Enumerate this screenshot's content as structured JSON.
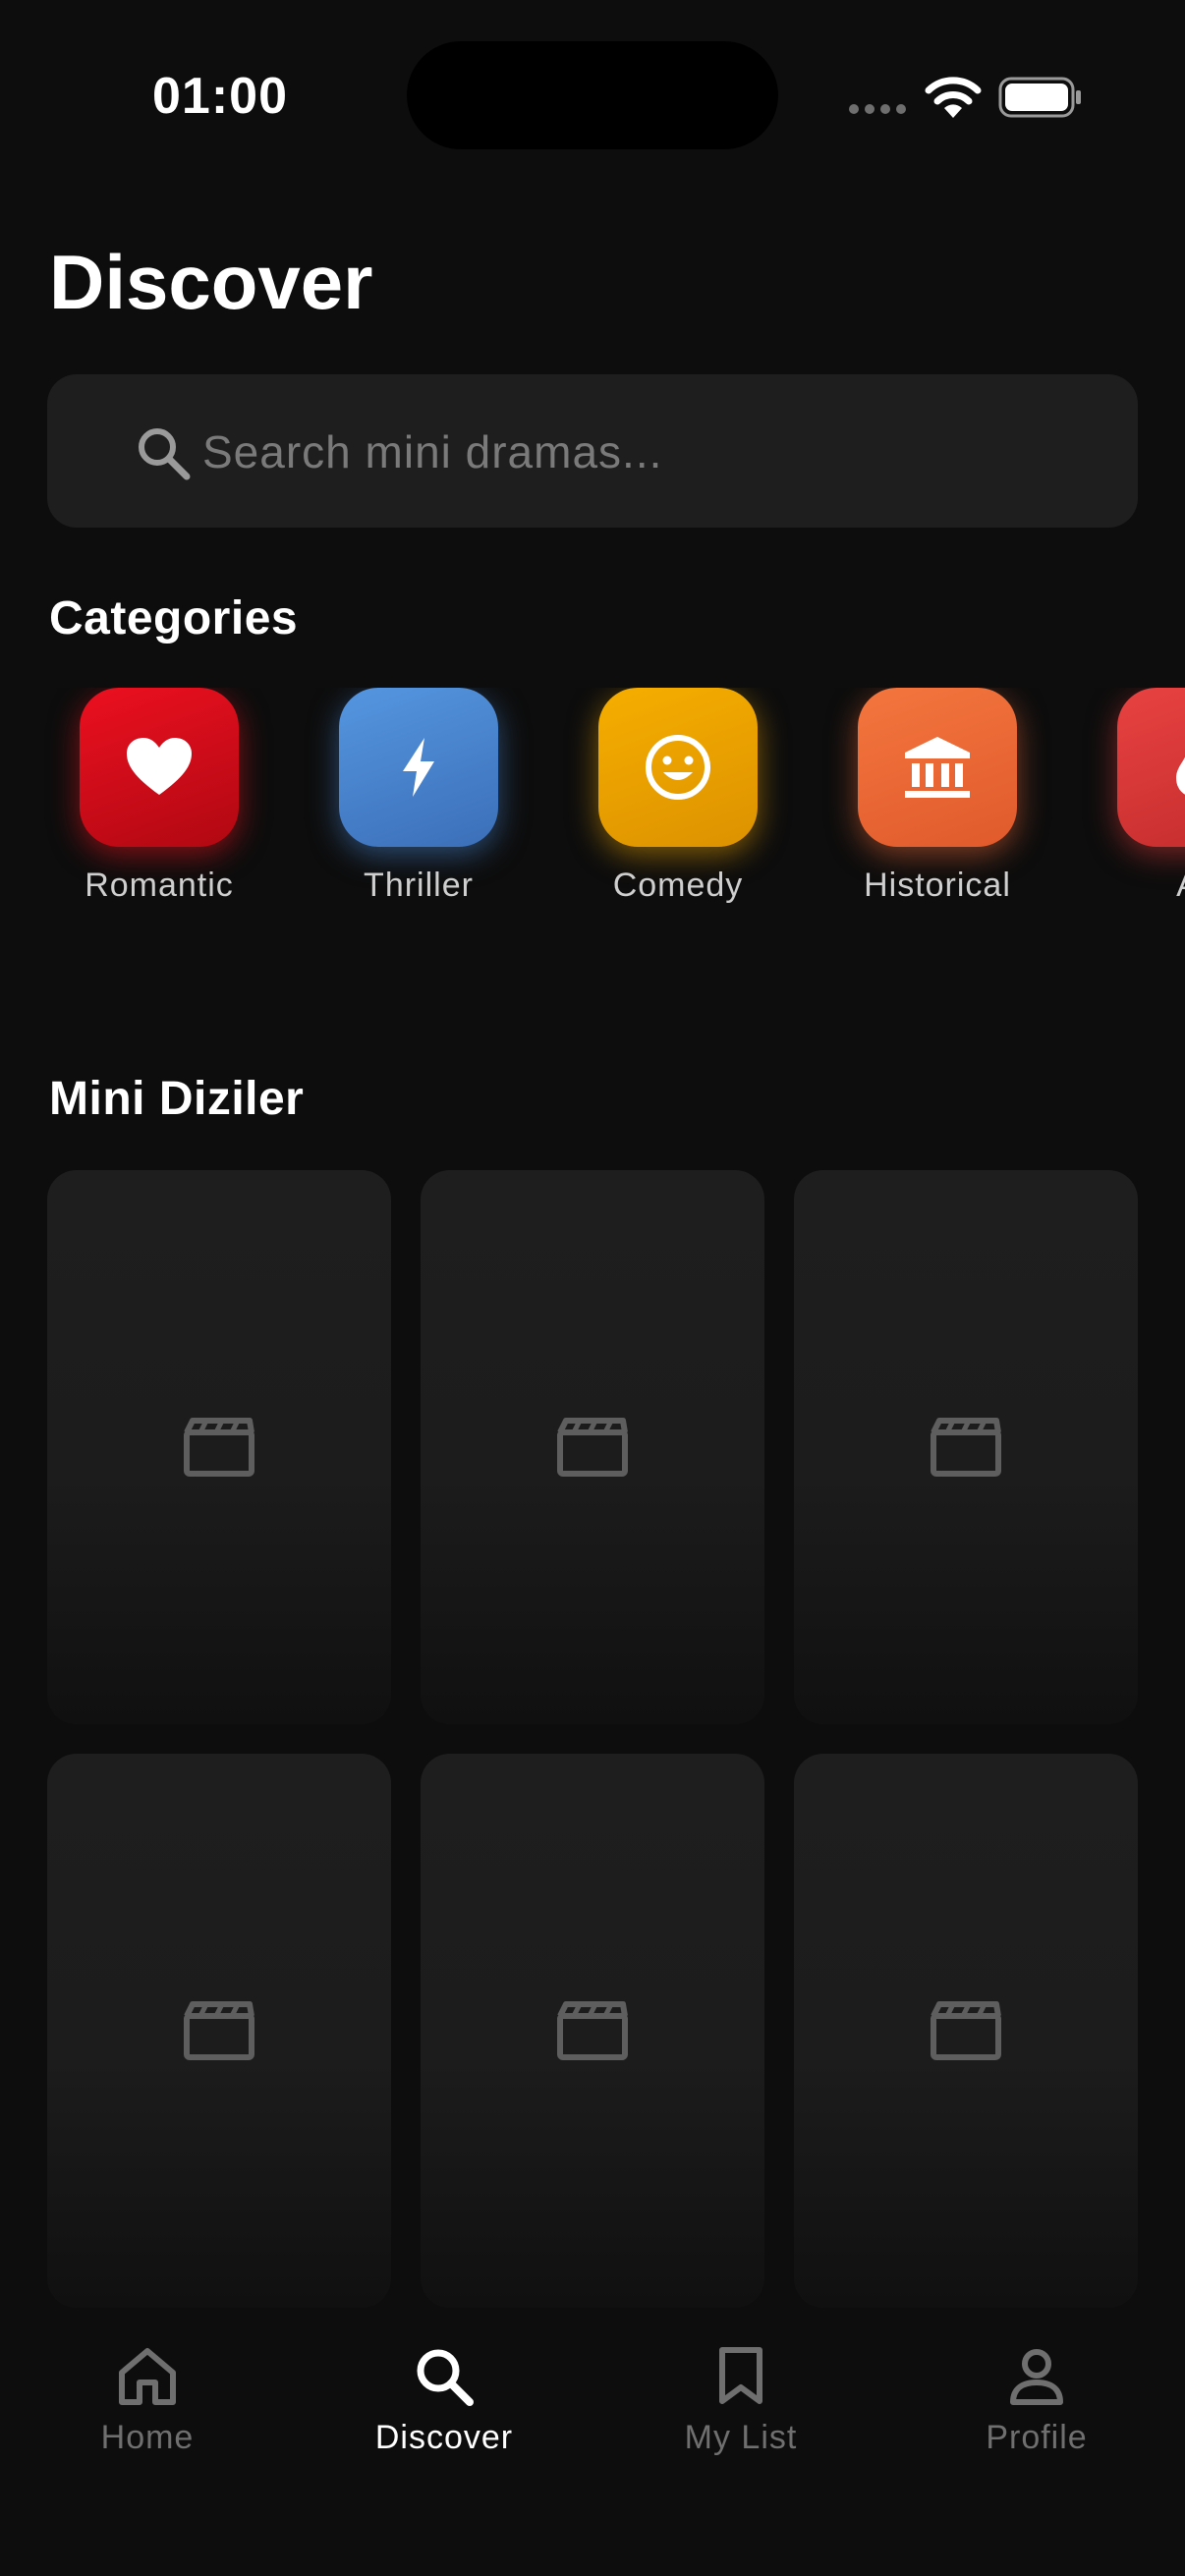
{
  "status_bar": {
    "time": "01:00"
  },
  "header": {
    "title": "Discover"
  },
  "search": {
    "placeholder": "Search mini dramas..."
  },
  "categories": {
    "heading": "Categories",
    "items": [
      {
        "label": "Romantic",
        "icon": "heart-icon",
        "color": "#e01020"
      },
      {
        "label": "Thriller",
        "icon": "bolt-icon",
        "color": "#4a8ad8"
      },
      {
        "label": "Comedy",
        "icon": "smiley-icon",
        "color": "#f2a800"
      },
      {
        "label": "Historical",
        "icon": "bank-icon",
        "color": "#f06a38"
      },
      {
        "label": "Ac",
        "icon": "flame-icon",
        "color": "#e03a3a"
      }
    ]
  },
  "mini_series": {
    "heading": "Mini Diziler",
    "card_icon": "clapperboard-icon",
    "card_count": 6
  },
  "bottom_nav": {
    "items": [
      {
        "label": "Home",
        "icon": "home-icon",
        "active": false
      },
      {
        "label": "Discover",
        "icon": "search-icon",
        "active": true
      },
      {
        "label": "My List",
        "icon": "bookmark-icon",
        "active": false
      },
      {
        "label": "Profile",
        "icon": "person-icon",
        "active": false
      }
    ]
  },
  "colors": {
    "background": "#0d0d0d",
    "surface": "#1e1e1e",
    "muted_text": "#6f6f6f"
  }
}
